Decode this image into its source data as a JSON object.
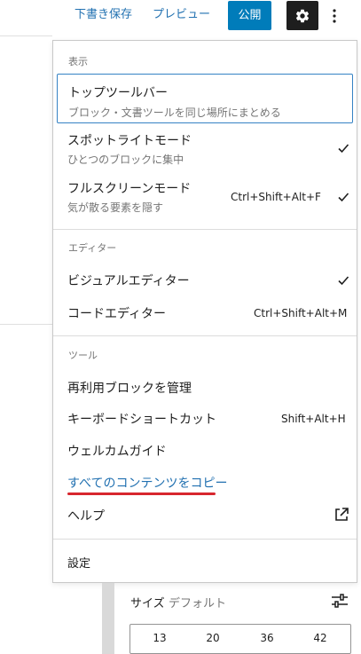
{
  "toolbar": {
    "save_draft": "下書き保存",
    "preview": "プレビュー",
    "publish": "公開",
    "settings_icon": "gear-icon",
    "more_icon": "vertical-ellipsis-icon"
  },
  "menu": {
    "view_group": {
      "label": "表示",
      "items": [
        {
          "title": "トップツールバー",
          "description": "ブロック・文書ツールを同じ場所にまとめる",
          "checked": false,
          "focused": true
        },
        {
          "title": "スポットライトモード",
          "description": "ひとつのブロックに集中",
          "checked": true
        },
        {
          "title": "フルスクリーンモード",
          "description": "気が散る要素を隠す",
          "shortcut": "Ctrl+Shift+Alt+F",
          "checked": true
        }
      ]
    },
    "editor_group": {
      "label": "エディター",
      "items": [
        {
          "title": "ビジュアルエディター",
          "checked": true
        },
        {
          "title": "コードエディター",
          "shortcut": "Ctrl+Shift+Alt+M"
        }
      ]
    },
    "tools_group": {
      "label": "ツール",
      "items": [
        {
          "title": "再利用ブロックを管理"
        },
        {
          "title": "キーボードショートカット",
          "shortcut": "Shift+Alt+H"
        },
        {
          "title": "ウェルカムガイド"
        },
        {
          "title": "すべてのコンテンツをコピー",
          "highlight_color": "#2271b1",
          "underline_color": "#d7262e"
        },
        {
          "title": "ヘルプ",
          "icon": "external-link-icon"
        }
      ]
    },
    "settings_item": {
      "title": "設定"
    }
  },
  "font_size_panel": {
    "label": "サイズ",
    "value": "デフォルト",
    "toggle_icon": "sliders-icon",
    "sizes": [
      "13",
      "20",
      "36",
      "42"
    ]
  },
  "colors": {
    "accent": "#2271b1",
    "publish_button": "#007cba",
    "focus_border": "#3582c4",
    "red_mark": "#d7262e"
  }
}
